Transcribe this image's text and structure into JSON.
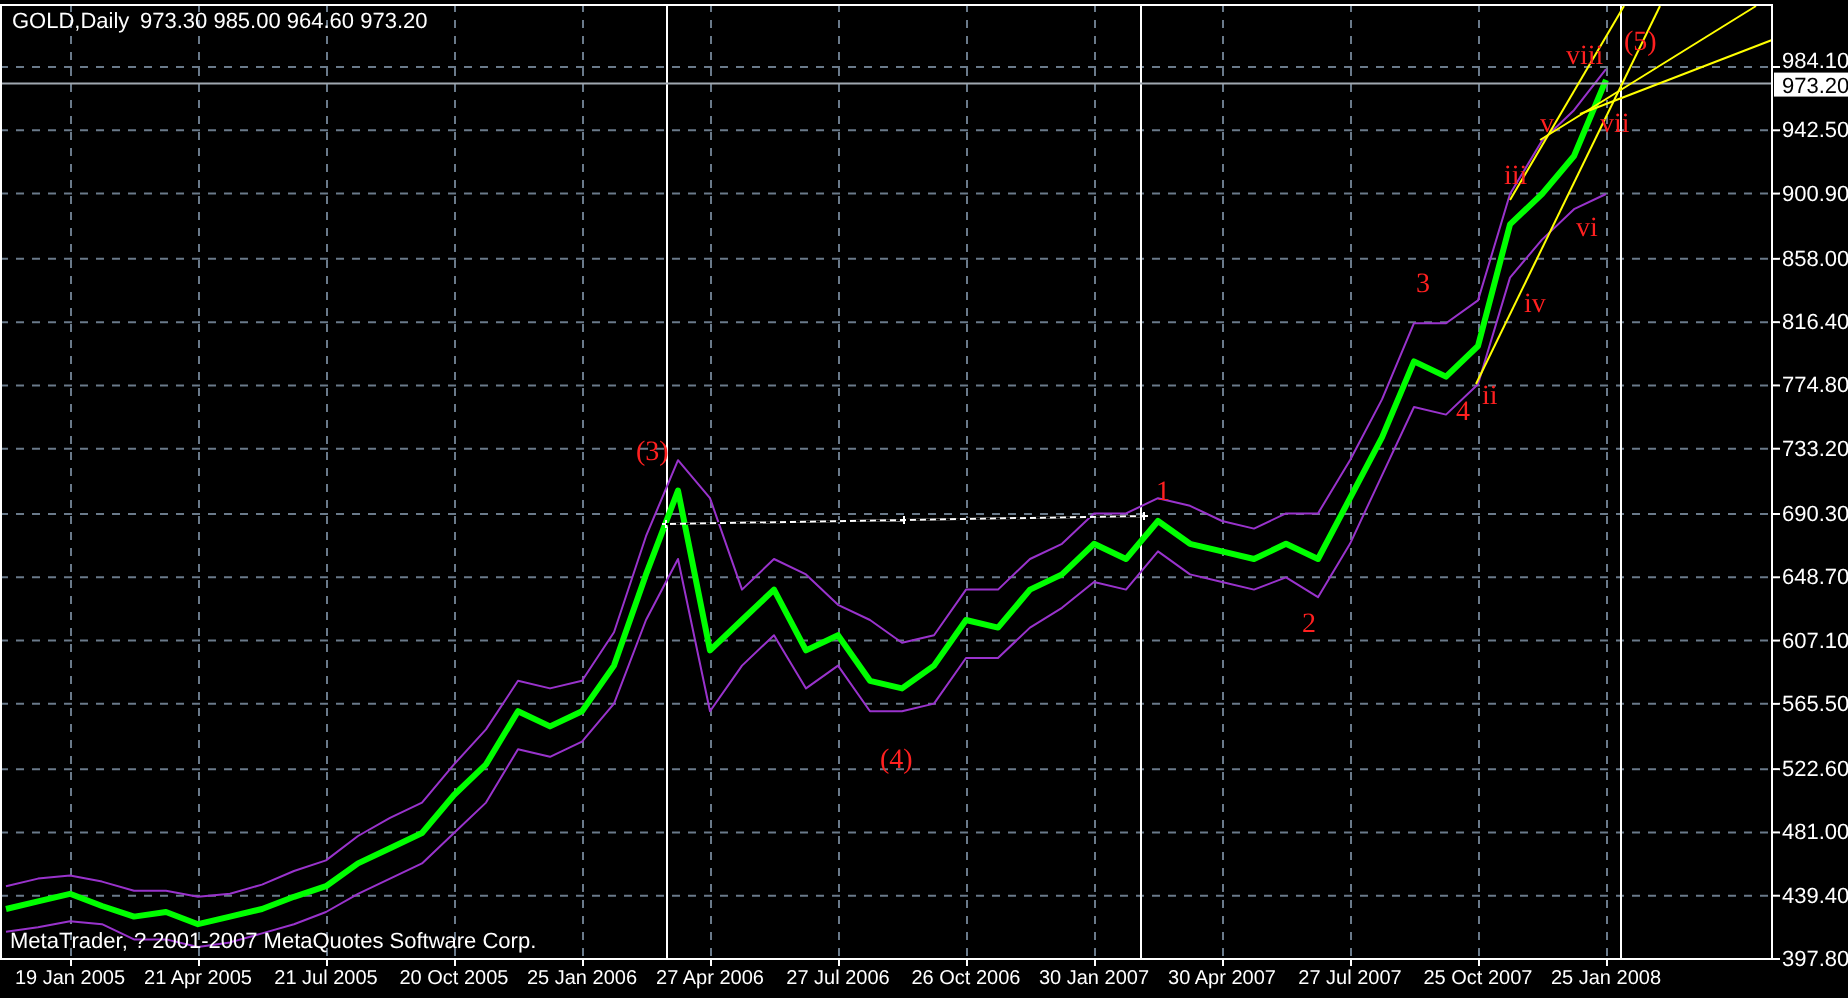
{
  "chart": {
    "symbol": "GOLD,Daily",
    "ohlc": "973.30 985.00 964.60 973.20",
    "current_price": "973.20",
    "copyright": "MetaTrader, ? 2001-2007 MetaQuotes Software Corp.",
    "wave_labels": [
      "(3)",
      "(4)",
      "1",
      "2",
      "3",
      "4",
      "ii",
      "iv",
      "iii",
      "v",
      "vi",
      "vii",
      "viii",
      "(5)"
    ],
    "chart_data": {
      "type": "line",
      "categories": [
        null,
        null,
        "19 Jan 2005",
        null,
        null,
        null,
        "21 Apr 2005",
        null,
        null,
        null,
        "21 Jul 2005",
        null,
        null,
        null,
        "20 Oct 2005",
        null,
        null,
        null,
        "25 Jan 2006",
        null,
        null,
        null,
        "27 Apr 2006",
        null,
        null,
        null,
        "27 Jul 2006",
        null,
        null,
        null,
        "26 Oct 2006",
        null,
        null,
        null,
        "30 Jan 2007",
        null,
        null,
        null,
        "30 Apr 2007",
        null,
        null,
        null,
        "27 Jul 2007",
        null,
        null,
        null,
        "25 Oct 2007",
        null,
        null,
        null,
        "25 Jan 2008"
      ],
      "grid": true,
      "ref_lines": [
        {
          "axis": "y",
          "value": 973.2
        }
      ],
      "series": [
        {
          "color": "#00ff00",
          "values": [
            430,
            435,
            440,
            432,
            425,
            428,
            420,
            425,
            430,
            438,
            445,
            460,
            470,
            480,
            505,
            525,
            560,
            550,
            560,
            590,
            650,
            705,
            600,
            620,
            640,
            600,
            610,
            580,
            575,
            590,
            620,
            615,
            640,
            650,
            670,
            660,
            685,
            670,
            665,
            660,
            670,
            660,
            700,
            740,
            790,
            780,
            800,
            880,
            900,
            925,
            975
          ]
        },
        {
          "color": "#9933cc",
          "values": [
            445,
            450,
            452,
            448,
            442,
            442,
            438,
            440,
            446,
            455,
            462,
            478,
            490,
            500,
            525,
            548,
            580,
            575,
            580,
            612,
            675,
            725,
            700,
            640,
            660,
            650,
            630,
            620,
            605,
            610,
            640,
            640,
            660,
            670,
            690,
            690,
            700,
            695,
            685,
            680,
            690,
            690,
            725,
            765,
            815,
            815,
            830,
            900,
            935,
            955,
            982
          ]
        },
        {
          "color": "#9933cc",
          "values": [
            415,
            418,
            422,
            420,
            410,
            410,
            405,
            408,
            414,
            420,
            428,
            440,
            450,
            460,
            480,
            500,
            535,
            530,
            540,
            565,
            620,
            660,
            560,
            590,
            610,
            575,
            590,
            560,
            560,
            565,
            595,
            595,
            615,
            628,
            645,
            640,
            665,
            650,
            645,
            640,
            648,
            635,
            670,
            715,
            760,
            755,
            775,
            845,
            870,
            890,
            900
          ]
        }
      ],
      "ylim": [
        397.8,
        984.1
      ],
      "yticks": [
        {
          "value": 984.1,
          "label": "984.10"
        },
        {
          "value": 942.5,
          "label": "942.50"
        },
        {
          "value": 900.9,
          "label": "900.90"
        },
        {
          "value": 858,
          "label": "858.00"
        },
        {
          "value": 816.4,
          "label": "816.40"
        },
        {
          "value": 774.8,
          "label": "774.80"
        },
        {
          "value": 733.2,
          "label": "733.20"
        },
        {
          "value": 690.3,
          "label": "690.30"
        },
        {
          "value": 648.7,
          "label": "648.70"
        },
        {
          "value": 607.1,
          "label": "607.10"
        },
        {
          "value": 565.5,
          "label": "565.50"
        },
        {
          "value": 522.6,
          "label": "522.60"
        },
        {
          "value": 481,
          "label": "481.00"
        },
        {
          "value": 439.4,
          "label": "439.40"
        },
        {
          "value": 397.8,
          "label": "397.80"
        }
      ]
    }
  }
}
